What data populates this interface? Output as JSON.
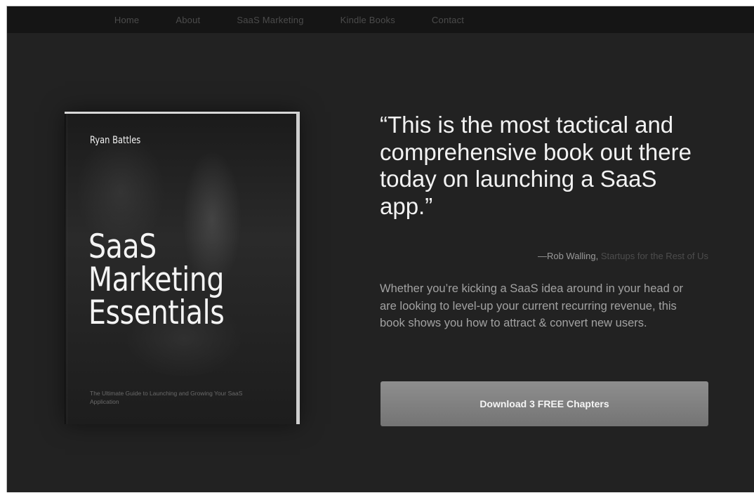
{
  "nav": {
    "items": [
      {
        "label": "Home"
      },
      {
        "label": "About"
      },
      {
        "label": "SaaS Marketing"
      },
      {
        "label": "Kindle Books"
      },
      {
        "label": "Contact"
      }
    ]
  },
  "book": {
    "author": "Ryan Battles",
    "title_lines": [
      "SaaS",
      "Marketing",
      "Essentials"
    ],
    "subtitle": "The Ultimate Guide to Launching and Growing Your SaaS Application"
  },
  "testimonial": {
    "quote": "“This is the most tactical and comprehensive book out there today on launching a SaaS app.”",
    "author": "—Rob Walling,",
    "source": "Startups for the Rest of Us"
  },
  "description": "Whether you’re kicking a SaaS idea around in your head or are looking to level-up your current recurring revenue, this book shows you how to attract & convert new users.",
  "cta": {
    "label": "Download 3 FREE Chapters"
  }
}
